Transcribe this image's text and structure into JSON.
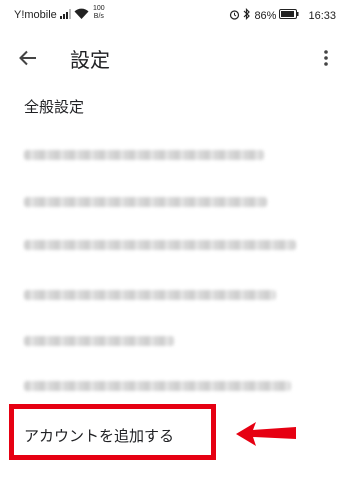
{
  "status_bar": {
    "carrier": "Y!mobile",
    "speed_value": "100",
    "speed_unit": "B/s",
    "battery": "86%",
    "time": "16:33"
  },
  "app_bar": {
    "title": "設定"
  },
  "general_settings": "全般設定",
  "add_account": "アカウントを追加する",
  "colors": {
    "highlight": "#e60012",
    "text": "#202124"
  },
  "icons": {
    "back": "arrow-left-icon",
    "overflow": "more-vert-icon"
  }
}
